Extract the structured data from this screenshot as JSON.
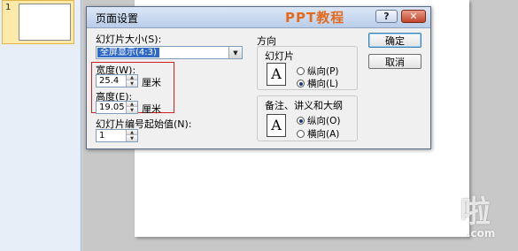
{
  "app": {
    "slide_panel": {
      "slide_number": "1",
      "thumb_number": "1"
    }
  },
  "dialog": {
    "title": "页面设置",
    "title_watermark": "PPT教程",
    "help_label": "?",
    "close_label": "✕",
    "slide_size_label": "幻灯片大小(S):",
    "slide_size_value": "全屏显示(4:3)",
    "width_label": "宽度(W):",
    "width_value": "25.4",
    "width_unit": "厘米",
    "height_label": "高度(E):",
    "height_value": "19.05",
    "height_unit": "厘米",
    "start_number_label": "幻灯片编号起始值(N):",
    "start_number_value": "1",
    "orientation": {
      "title": "方向",
      "slides": {
        "title": "幻灯片",
        "portrait_label": "纵向(P)",
        "landscape_label": "横向(L)",
        "selected": "landscape"
      },
      "notes": {
        "title": "备注、讲义和大纲",
        "portrait_label": "纵向(O)",
        "landscape_label": "横向(A)",
        "selected": "portrait"
      },
      "page_glyph": "A"
    },
    "ok_label": "确定",
    "cancel_label": "取消"
  },
  "watermark": {
    "logo": "啦",
    "domain": ".com"
  },
  "colors": {
    "titlebar": "#c9d9ef",
    "selection": "#3169c6",
    "highlight_box": "#d02020",
    "close_button": "#c2452a",
    "title_watermark": "#e36b1e"
  }
}
